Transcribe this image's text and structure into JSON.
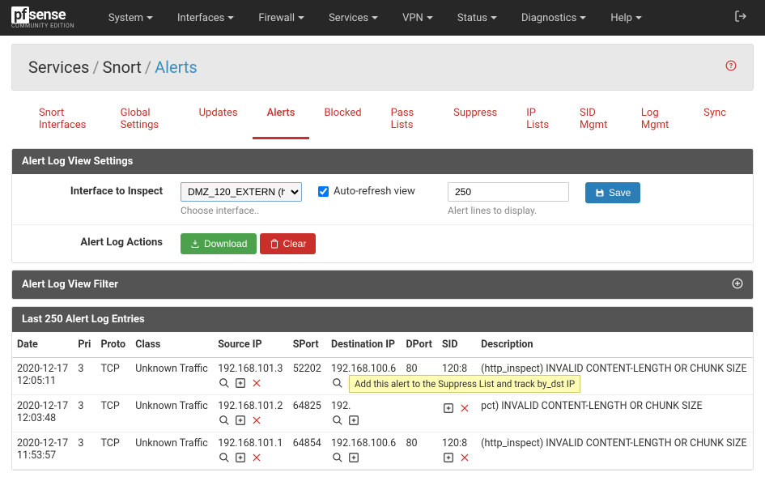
{
  "navbar": {
    "logo_main_a": "pf",
    "logo_main_b": "sense",
    "logo_sub": "COMMUNITY EDITION",
    "items": [
      "System",
      "Interfaces",
      "Firewall",
      "Services",
      "VPN",
      "Status",
      "Diagnostics",
      "Help"
    ]
  },
  "breadcrumb": {
    "parts": [
      "Services",
      "Snort",
      "Alerts"
    ]
  },
  "tabs": {
    "items": [
      "Snort Interfaces",
      "Global Settings",
      "Updates",
      "Alerts",
      "Blocked",
      "Pass Lists",
      "Suppress",
      "IP Lists",
      "SID Mgmt",
      "Log Mgmt",
      "Sync"
    ],
    "active": "Alerts"
  },
  "settings_panel": {
    "title": "Alert Log View Settings",
    "iface_label": "Interface to Inspect",
    "iface_value": "DMZ_120_EXTERN (h",
    "iface_helper": "Choose interface..",
    "auto_refresh_label": "Auto-refresh view",
    "lines_value": "250",
    "lines_helper": "Alert lines to display.",
    "save_label": "Save",
    "actions_label": "Alert Log Actions",
    "download_label": "Download",
    "clear_label": "Clear"
  },
  "filter_panel": {
    "title": "Alert Log View Filter"
  },
  "entries_panel": {
    "title": "Last 250 Alert Log Entries",
    "columns": [
      "Date",
      "Pri",
      "Proto",
      "Class",
      "Source IP",
      "SPort",
      "Destination IP",
      "DPort",
      "SID",
      "Description"
    ],
    "rows": [
      {
        "date": "2020-12-17 12:05:11",
        "pri": "3",
        "proto": "TCP",
        "class": "Unknown Traffic",
        "src": "192.168.101.3",
        "sport": "52202",
        "dst": "192.168.100.6",
        "dport": "80",
        "sid": "120:8",
        "desc": "(http_inspect) INVALID CONTENT-LENGTH OR CHUNK SIZE",
        "highlight_dst_plus": true,
        "tooltip": "Add this alert to the Suppress List and track by_dst IP"
      },
      {
        "date": "2020-12-17 12:03:48",
        "pri": "3",
        "proto": "TCP",
        "class": "Unknown Traffic",
        "src": "192.168.101.2",
        "sport": "64825",
        "dst": "192.",
        "dport": "",
        "sid": "",
        "desc": "pct) INVALID CONTENT-LENGTH OR CHUNK SIZE"
      },
      {
        "date": "2020-12-17 11:53:57",
        "pri": "3",
        "proto": "TCP",
        "class": "Unknown Traffic",
        "src": "192.168.101.1",
        "sport": "64854",
        "dst": "192.168.100.6",
        "dport": "80",
        "sid": "120:8",
        "desc": "(http_inspect) INVALID CONTENT-LENGTH OR CHUNK SIZE"
      }
    ]
  }
}
